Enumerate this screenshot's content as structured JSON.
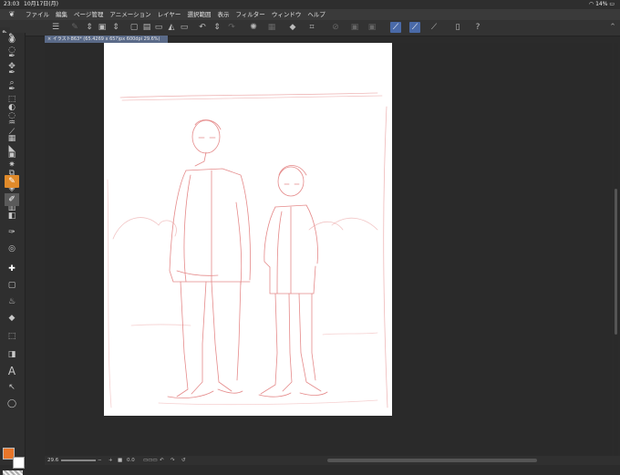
{
  "status": {
    "time": "23:03",
    "date": "10月17日(月)",
    "battery": "14%"
  },
  "menu": {
    "items": [
      "ファイル",
      "編集",
      "ページ管理",
      "アニメーション",
      "レイヤー",
      "選択範囲",
      "表示",
      "フィルター",
      "ウィンドウ",
      "ヘルプ"
    ]
  },
  "tab": {
    "label": "× イラスト863* (65.4269 x 65?)px 600dpi 29.6%)"
  },
  "bottom": {
    "zoom": "29.6",
    "angle": "0.0"
  },
  "colors": {
    "main": "#e8762a",
    "sub": "#ffffff",
    "accent": "#4a6aa8",
    "sketch": "#e07a7a"
  },
  "toolbar": {
    "icons": [
      "menu-icon",
      "new-file-icon",
      "fill-icon",
      "layer-icon",
      "sort-icon",
      "save-icon",
      "up-down-icon",
      "adjust-icon",
      "up-down-icon",
      "undo-icon",
      "redo-icon",
      "spinner-icon",
      "stamp-icon",
      "bucket-icon",
      "crop-icon",
      "slash-icon",
      "box-icon",
      "box-icon",
      "pen-icon",
      "pen-icon",
      "pen-icon",
      "tablet-icon",
      "help-icon"
    ]
  },
  "tools": {
    "icons": [
      "magnifier-icon",
      "pen-nib-icon",
      "pen-nib-icon",
      "pen-nib-icon",
      "circle-icon",
      "fill-drop-icon",
      "grid-icon",
      "frame-icon",
      "layer-icon",
      "stack-icon",
      "trash-icon"
    ]
  },
  "mainTools": {
    "icons": [
      "brush-icon",
      "lasso-icon",
      "move-icon",
      "zoom-icon",
      "select-icon",
      "rotate-icon",
      "eyedropper-icon",
      "triangle-icon",
      "sparkle-icon",
      "pen-icon",
      "pencil-icon",
      "eraser-icon",
      "dropper-icon",
      "pattern-icon",
      "plus-icon",
      "square-icon",
      "drop-icon",
      "bucket-icon",
      "dotted-square-icon",
      "gradient-icon",
      "text-icon",
      "select-arrow-icon",
      "speech-icon"
    ]
  }
}
